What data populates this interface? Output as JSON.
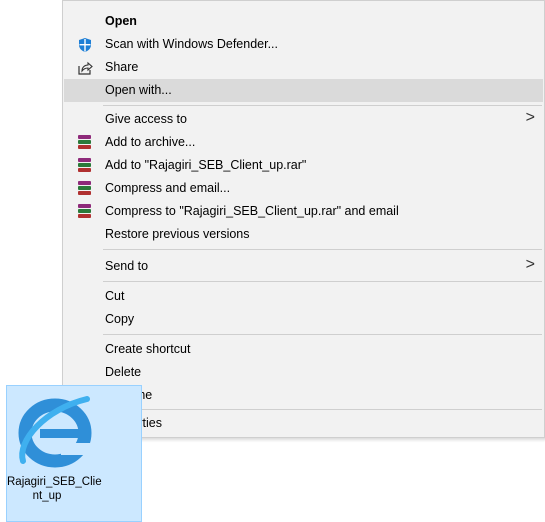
{
  "colors": {
    "menu_bg": "#f2f2f2",
    "highlight": "#dadada",
    "selection_bg": "#cce8ff",
    "defender_blue": "#1e7fd6"
  },
  "menu": {
    "open": "Open",
    "scan": "Scan with Windows Defender...",
    "share": "Share",
    "open_with": "Open with...",
    "give_access": "Give access to",
    "add_archive": "Add to archive...",
    "add_to_rar": "Add to \"Rajagiri_SEB_Client_up.rar\"",
    "compress_email": "Compress and email...",
    "compress_rar_email": "Compress to \"Rajagiri_SEB_Client_up.rar\" and email",
    "restore": "Restore previous versions",
    "send_to": "Send to",
    "cut": "Cut",
    "copy": "Copy",
    "create_shortcut": "Create shortcut",
    "delete": "Delete",
    "rename": "Rename",
    "properties": "Properties",
    "submenu_arrow": ">"
  },
  "icons": {
    "defender": "windows-defender-shield-icon",
    "share": "share-icon",
    "winrar": "winrar-books-icon",
    "file": "internet-explorer-icon"
  },
  "desktop": {
    "file_label_line1": "Rajagiri_SEB_Clie",
    "file_label_line2": "nt_up"
  }
}
